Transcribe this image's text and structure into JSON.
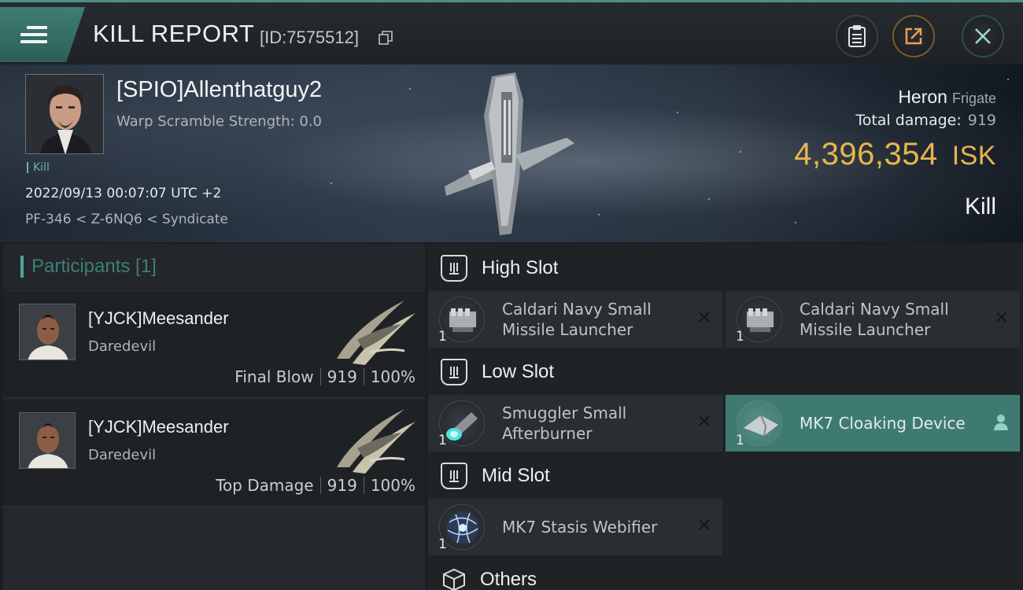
{
  "header": {
    "title": "KILL REPORT",
    "id_label": "[ID:7575512]"
  },
  "victim": {
    "name": "[SPIO]Allenthatguy2",
    "scramble": "Warp Scramble Strength: 0.0",
    "tag": "Kill",
    "date": "2022/09/13 00:07:07 UTC +2",
    "location": "PF-346 < Z-6NQ6 < Syndicate",
    "ship": "Heron",
    "ship_class": "Frigate",
    "total_damage_label": "Total damage:",
    "total_damage": "919",
    "isk_value": "4,396,354",
    "isk_unit": "ISK",
    "result": "Kill"
  },
  "participants": {
    "header": "Participants [1]",
    "items": [
      {
        "name": "[YJCK]Meesander",
        "ship": "Daredevil",
        "role": "Final Blow",
        "damage": "919",
        "percent": "100%"
      },
      {
        "name": "[YJCK]Meesander",
        "ship": "Daredevil",
        "role": "Top Damage",
        "damage": "919",
        "percent": "100%"
      }
    ]
  },
  "fitting": {
    "high_slot": "High Slot",
    "low_slot": "Low Slot",
    "mid_slot": "Mid Slot",
    "others": "Others",
    "high": [
      {
        "name": "Caldari Navy Small Missile Launcher",
        "qty": "1"
      },
      {
        "name": "Caldari Navy Small Missile Launcher",
        "qty": "1"
      }
    ],
    "low": [
      {
        "name": "Smuggler Small Afterburner",
        "qty": "1"
      },
      {
        "name": "MK7 Cloaking Device",
        "qty": "1"
      }
    ],
    "mid": [
      {
        "name": "MK7 Stasis Webifier",
        "qty": "1"
      }
    ],
    "remove_glyph": "✕"
  },
  "colors": {
    "accent": "#4fa497",
    "isk": "#e8b64c",
    "selected": "#3f7a72"
  },
  "icons": {
    "menu": "hamburger-icon",
    "copy": "copy-icon",
    "report": "clipboard-icon",
    "share": "share-icon",
    "close": "close-icon",
    "slot": "slot-icon",
    "others": "cube-icon",
    "user": "user-icon"
  }
}
